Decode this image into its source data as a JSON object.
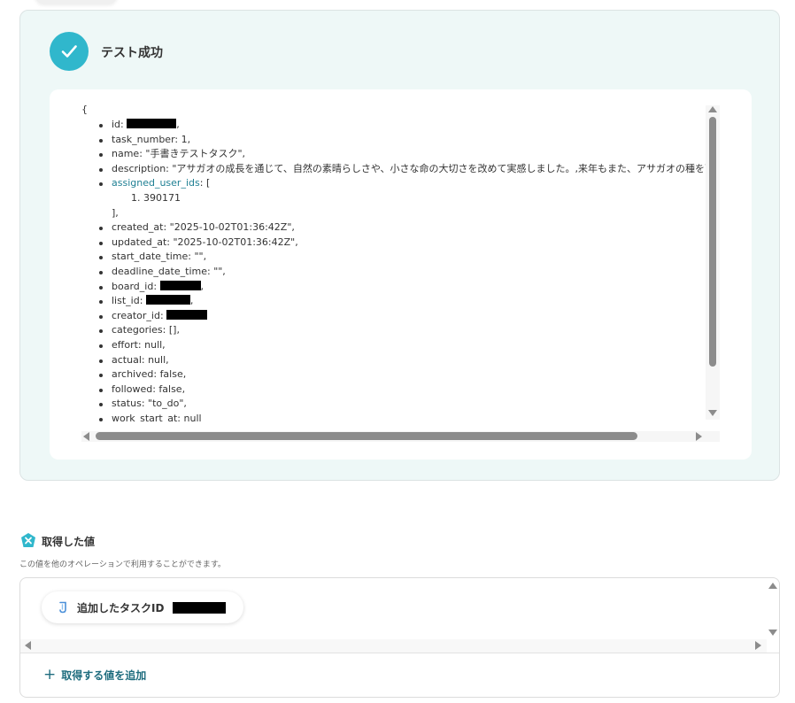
{
  "test_result": {
    "status_title": "テスト成功",
    "json_open": "{",
    "fields": [
      {
        "key": "id",
        "value": ",",
        "redacted": true
      },
      {
        "key": "task_number",
        "value": "1,"
      },
      {
        "key": "name",
        "value": "\"手書きテストタスク\","
      },
      {
        "key": "description",
        "value": "\"アサガオの成長を通じて、自然の素晴らしさや、小さな命の大切さを改めて実感しました。,来年もまた、アサガオの種を蒔こう"
      },
      {
        "key": "assigned_user_ids",
        "value": "[",
        "link": true
      },
      {
        "key": "created_at",
        "value": "\"2025-10-02T01:36:42Z\","
      },
      {
        "key": "updated_at",
        "value": "\"2025-10-02T01:36:42Z\","
      },
      {
        "key": "start_date_time",
        "value": "\"\","
      },
      {
        "key": "deadline_date_time",
        "value": "\"\","
      },
      {
        "key": "board_id",
        "value": ",",
        "redacted": true
      },
      {
        "key": "list_id",
        "value": ",",
        "redacted": true
      },
      {
        "key": "creator_id",
        "value": "",
        "redacted": true
      },
      {
        "key": "categories",
        "value": "[],"
      },
      {
        "key": "effort",
        "value": "null,"
      },
      {
        "key": "actual",
        "value": "null,"
      },
      {
        "key": "archived",
        "value": "false,"
      },
      {
        "key": "followed",
        "value": "false,"
      },
      {
        "key": "status",
        "value": "\"to_do\","
      },
      {
        "key": "work_start_at",
        "value": "null"
      }
    ],
    "assigned_user_item": "1. 390171",
    "assigned_user_close": "],"
  },
  "acquired_values": {
    "title": "取得した値",
    "description": "この値を他のオペレーションで利用することができます。",
    "chip_label": "追加したタスクID",
    "add_button_label": "取得する値を追加"
  },
  "colors": {
    "accent": "#30b7cc",
    "link": "#1e7f93",
    "panel_bg": "#eef8f7"
  }
}
